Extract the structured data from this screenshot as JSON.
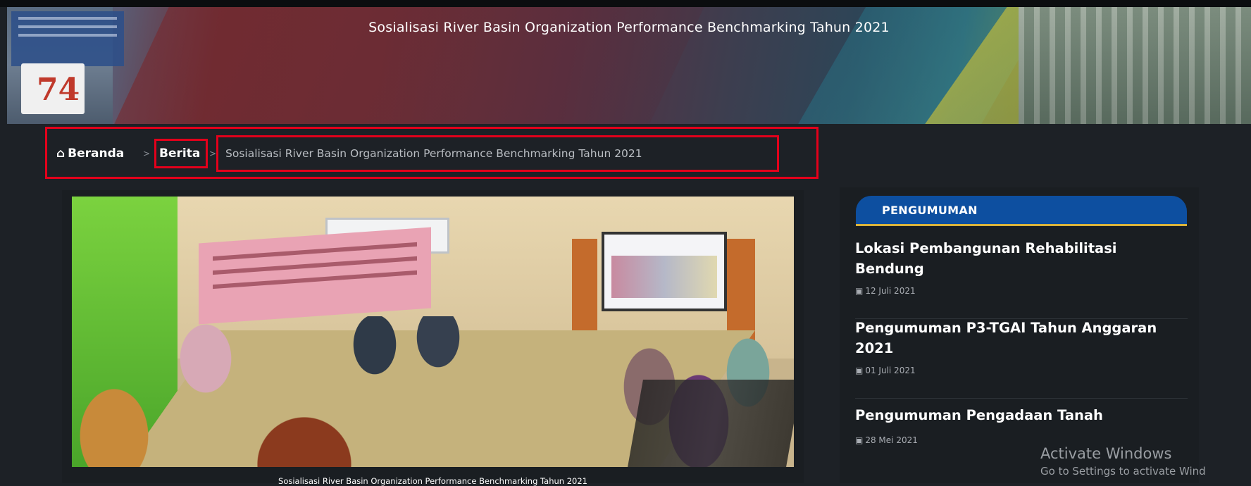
{
  "hero": {
    "title": "Sosialisasi River Basin Organization Performance Benchmarking Tahun 2021",
    "logo_text": "74"
  },
  "breadcrumb": {
    "home_icon": "home-icon",
    "home": "Beranda",
    "separator": ">",
    "section": "Berita",
    "current": "Sosialisasi River Basin Organization Performance Benchmarking Tahun 2021"
  },
  "article": {
    "caption": "Sosialisasi River Basin Organization Performance Benchmarking Tahun 2021"
  },
  "sidebar": {
    "header": "PENGUMUMAN",
    "accent_color": "#0d4fa0",
    "calendar_icon": "calendar-icon",
    "items": [
      {
        "title": "Lokasi Pembangunan Rehabilitasi Bendung",
        "date": "12 Juli 2021"
      },
      {
        "title": "Pengumuman P3-TGAI Tahun Anggaran 2021",
        "date": "01 Juli 2021"
      },
      {
        "title": "Pengumuman Pengadaan Tanah",
        "date": "28 Mei 2021"
      }
    ]
  },
  "watermark": {
    "line1": "Activate Windows",
    "line2": "Go to Settings to activate Wind"
  }
}
